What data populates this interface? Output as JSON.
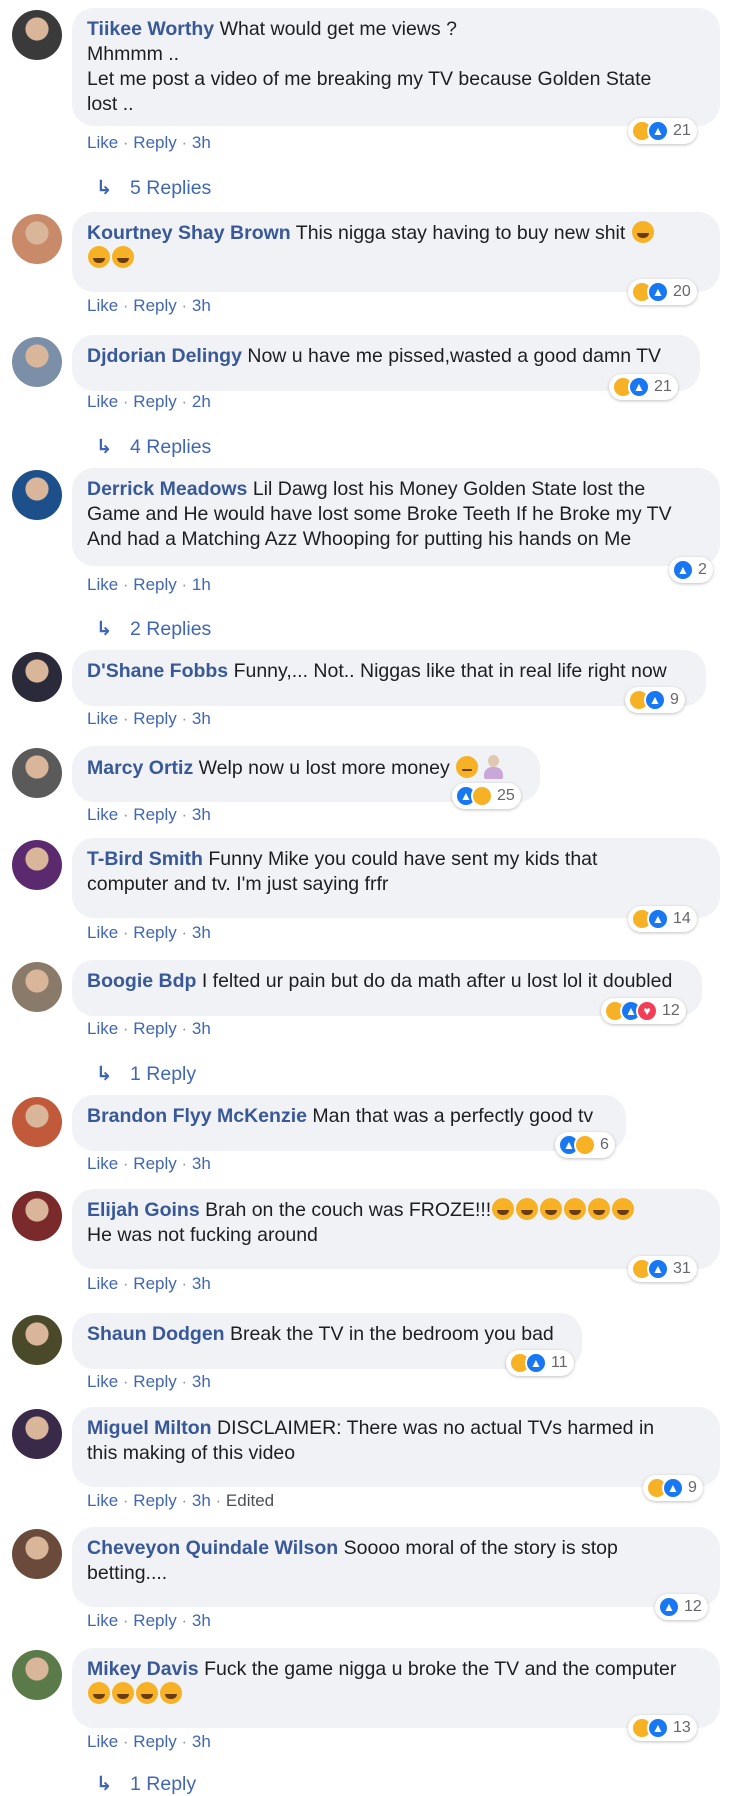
{
  "comments": [
    {
      "author": "Tiikee Worthy",
      "lines": [
        "What would get me views ?",
        "Mhmmm ..",
        "Let me post a video of me breaking my TV because Golden State",
        "lost .."
      ],
      "emojis": 0,
      "time": "3h",
      "edited": "",
      "reaction_count": "21",
      "reactions": [
        "haha",
        "like"
      ],
      "replies": "5 Replies"
    },
    {
      "author": "Kourtney Shay Brown",
      "lines": [
        "This nigga stay having to buy new shit"
      ],
      "emojis": 3,
      "time": "3h",
      "edited": "",
      "reaction_count": "20",
      "reactions": [
        "haha",
        "like"
      ],
      "replies": ""
    },
    {
      "author": "Djdorian Delingy",
      "lines": [
        "Now u have me pissed,wasted a good damn TV"
      ],
      "emojis": 0,
      "time": "2h",
      "edited": "",
      "reaction_count": "21",
      "reactions": [
        "haha",
        "like"
      ],
      "replies": "4 Replies"
    },
    {
      "author": "Derrick Meadows",
      "lines": [
        "Lil Dawg lost his Money Golden State lost the",
        "Game and He would have lost some Broke Teeth If he Broke my TV",
        "And had a Matching Azz Whooping for putting his hands on Me"
      ],
      "emojis": 0,
      "time": "1h",
      "edited": "",
      "reaction_count": "2",
      "reactions": [
        "like"
      ],
      "replies": "2 Replies"
    },
    {
      "author": "D'Shane Fobbs",
      "lines": [
        "Funny,... Not.. Niggas like that in real life right now"
      ],
      "emojis": 0,
      "time": "3h",
      "edited": "",
      "reaction_count": "9",
      "reactions": [
        "haha",
        "like"
      ],
      "replies": ""
    },
    {
      "author": "Marcy Ortiz",
      "lines": [
        "Welp now u lost more money"
      ],
      "emojis": 0,
      "time": "3h",
      "edited": "",
      "reaction_count": "25",
      "reactions": [
        "like",
        "haha"
      ],
      "replies": ""
    },
    {
      "author": "T-Bird Smith",
      "lines": [
        "Funny Mike you could have sent my kids that",
        "computer and tv. I'm just saying frfr"
      ],
      "emojis": 0,
      "time": "3h",
      "edited": "",
      "reaction_count": "14",
      "reactions": [
        "haha",
        "like"
      ],
      "replies": ""
    },
    {
      "author": "Boogie Bdp",
      "lines": [
        "I felted ur pain but do da math after u lost lol it doubled"
      ],
      "emojis": 0,
      "time": "3h",
      "edited": "",
      "reaction_count": "12",
      "reactions": [
        "haha",
        "like",
        "love"
      ],
      "replies": "1 Reply"
    },
    {
      "author": "Brandon Flyy McKenzie",
      "lines": [
        "Man that was a perfectly good tv"
      ],
      "emojis": 0,
      "time": "3h",
      "edited": "",
      "reaction_count": "6",
      "reactions": [
        "like",
        "haha"
      ],
      "replies": ""
    },
    {
      "author": "Elijah Goins",
      "lines": [
        "Brah on the couch was FROZE!!!",
        "He was not fucking around"
      ],
      "emojis": 6,
      "time": "3h",
      "edited": "",
      "reaction_count": "31",
      "reactions": [
        "haha",
        "like"
      ],
      "replies": ""
    },
    {
      "author": "Shaun Dodgen",
      "lines": [
        "Break the TV in the bedroom you bad"
      ],
      "emojis": 0,
      "time": "3h",
      "edited": "",
      "reaction_count": "11",
      "reactions": [
        "haha",
        "like"
      ],
      "replies": ""
    },
    {
      "author": "Miguel Milton",
      "lines": [
        "DISCLAIMER: There was no actual TVs harmed in",
        "this making of this video"
      ],
      "emojis": 0,
      "time": "3h",
      "edited": "Edited",
      "reaction_count": "9",
      "reactions": [
        "haha",
        "like"
      ],
      "replies": ""
    },
    {
      "author": "Cheveyon Quindale Wilson",
      "lines": [
        "Soooo moral of the story is stop",
        "betting...."
      ],
      "emojis": 0,
      "time": "3h",
      "edited": "",
      "reaction_count": "12",
      "reactions": [
        "like"
      ],
      "replies": ""
    },
    {
      "author": "Mikey Davis",
      "lines": [
        "Fuck the game nigga u broke the TV and the computer"
      ],
      "emojis": 4,
      "time": "3h",
      "edited": "",
      "reaction_count": "13",
      "reactions": [
        "haha",
        "like"
      ],
      "replies": "1 Reply"
    }
  ],
  "labels": {
    "like": "Like",
    "reply": "Reply",
    "sep": "·"
  },
  "colors": {
    "author": "#385898",
    "link": "#4267b2",
    "bubble": "#f0f2f5",
    "like": "#1877f2",
    "haha": "#f7b125",
    "love": "#f33e58"
  }
}
